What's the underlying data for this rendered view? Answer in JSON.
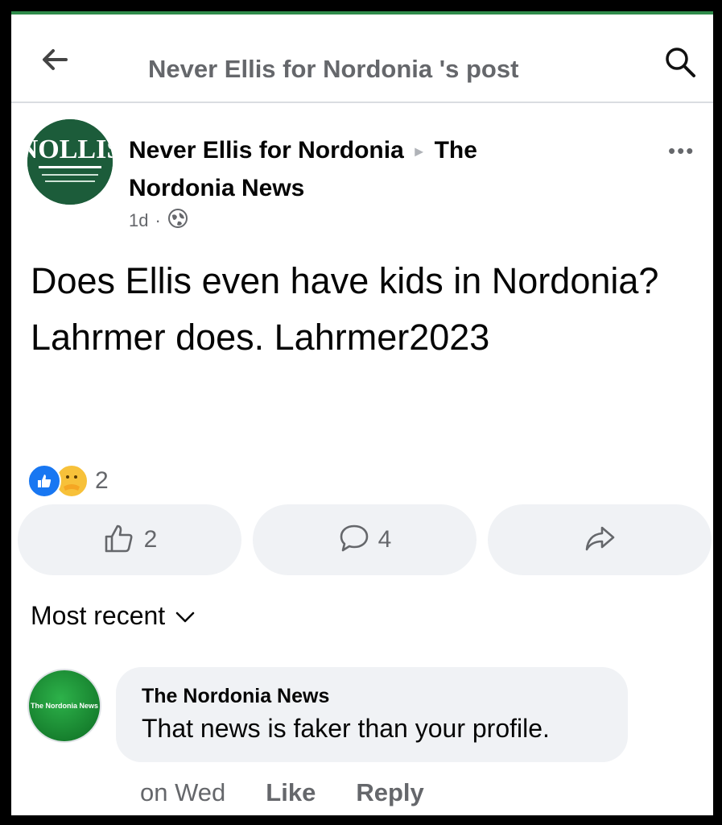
{
  "header": {
    "title": "Never Ellis for Nordonia 's post"
  },
  "post": {
    "author": "Never Ellis for Nordonia",
    "target_page": "The Nordonia News",
    "time": "1d",
    "separator": "·",
    "text": "Does Ellis even have kids in Nordonia? Lahrmer does. Lahrmer2023",
    "avatar_text": "NOLLIS"
  },
  "reactions": {
    "count": "2",
    "types": [
      "like-icon",
      "care-icon"
    ]
  },
  "actions": {
    "like_count": "2",
    "comment_count": "4"
  },
  "sort": {
    "label": "Most recent"
  },
  "comment": {
    "avatar_text": "The Nordonia News",
    "author": "The Nordonia News",
    "text": "That news is faker than your profile.",
    "time": "on Wed",
    "like_label": "Like",
    "reply_label": "Reply"
  },
  "colors": {
    "accent": "#1877f2",
    "top_bar": "#2e8b4a",
    "secondary_text": "#65676b",
    "button_bg": "#f0f2f5"
  }
}
